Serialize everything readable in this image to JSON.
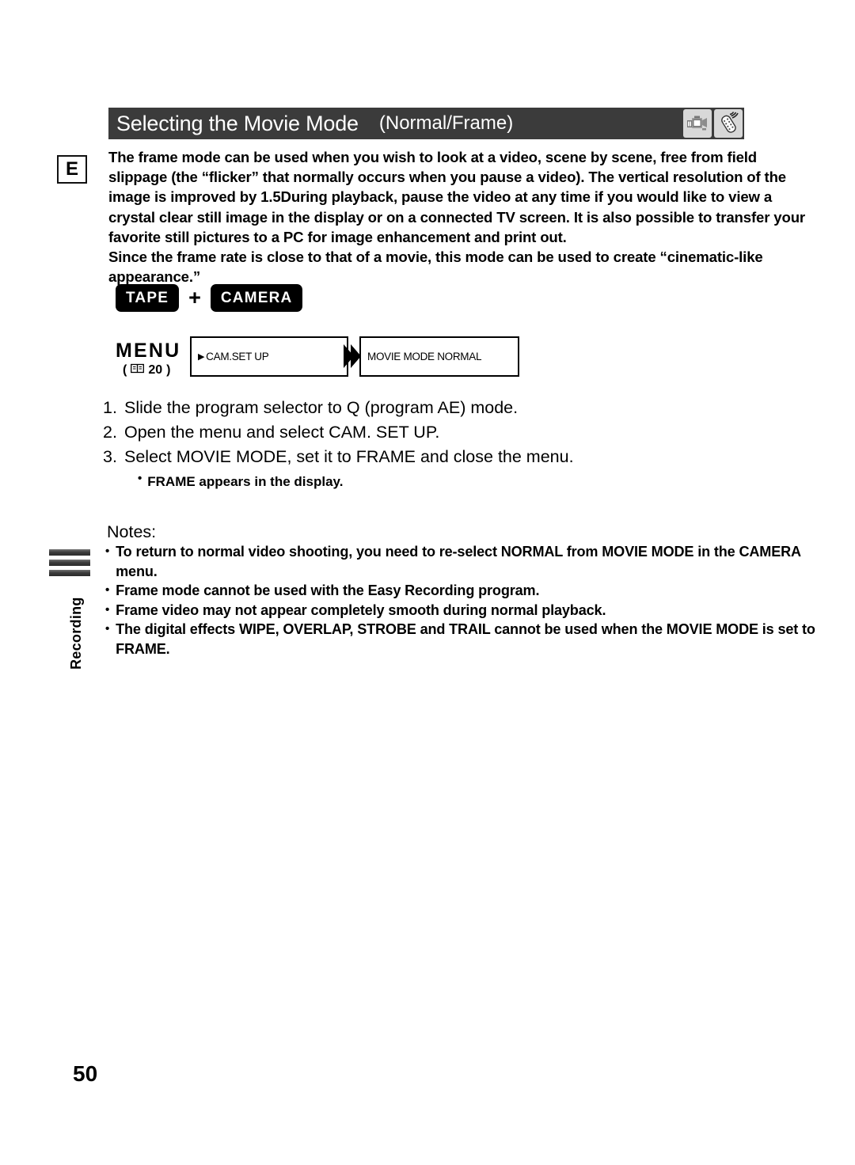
{
  "page": {
    "number": "50",
    "language_badge": "E",
    "side_tab_label": "Recording",
    "background_color": "#ffffff"
  },
  "header": {
    "title": "Selecting the Movie Mode",
    "subtitle": "(Normal/Frame)",
    "background_color": "#3b3b3b",
    "text_color": "#ffffff",
    "icons": [
      {
        "name": "camcorder-icon",
        "label": "Camcorder"
      },
      {
        "name": "remote-control-icon",
        "label": "Wireless Controller"
      }
    ]
  },
  "intro": {
    "paragraphs": [
      "The frame mode can be used when you wish to look at a video, scene by scene, free from field slippage (the “flicker” that normally occurs when you pause a video). The vertical resolution of the image is improved by 1.5During playback, pause the video at any time if you would like to view a crystal clear still image in the display or on a connected TV screen. It is also possible to transfer your favorite still pictures to a PC for image enhancement and print out.",
      "Since the frame rate is close to that of a movie, this mode can be used to create “cinematic-like appearance.”"
    ]
  },
  "mode_chips": {
    "first": "TAPE",
    "operator": "+",
    "second": "CAMERA"
  },
  "menu_flow": {
    "label": "MENU",
    "reference_prefix": "(",
    "reference_page": "20",
    "reference_suffix": ")",
    "boxes": [
      {
        "arrow": "▶",
        "text": "CAM.SET UP"
      },
      {
        "text": "MOVIE MODE   NORMAL"
      }
    ]
  },
  "steps": [
    {
      "num": "1.",
      "text": "Slide the program selector to Q    (program AE) mode."
    },
    {
      "num": "2.",
      "text": "Open the menu and select CAM. SET UP."
    },
    {
      "num": "3.",
      "text": "Select MOVIE MODE, set it to FRAME and close the menu.",
      "sub": "FRAME appears in the display."
    }
  ],
  "notes": {
    "title": "Notes:",
    "items": [
      "To return to normal video shooting, you need to re-select NORMAL from MOVIE MODE in the CAMERA menu.",
      "Frame mode cannot be used with the Easy Recording program.",
      "Frame video may not appear completely smooth during normal playback.",
      "The digital effects WIPE, OVERLAP, STROBE and TRAIL cannot be used when the MOVIE MODE is set to FRAME."
    ]
  }
}
